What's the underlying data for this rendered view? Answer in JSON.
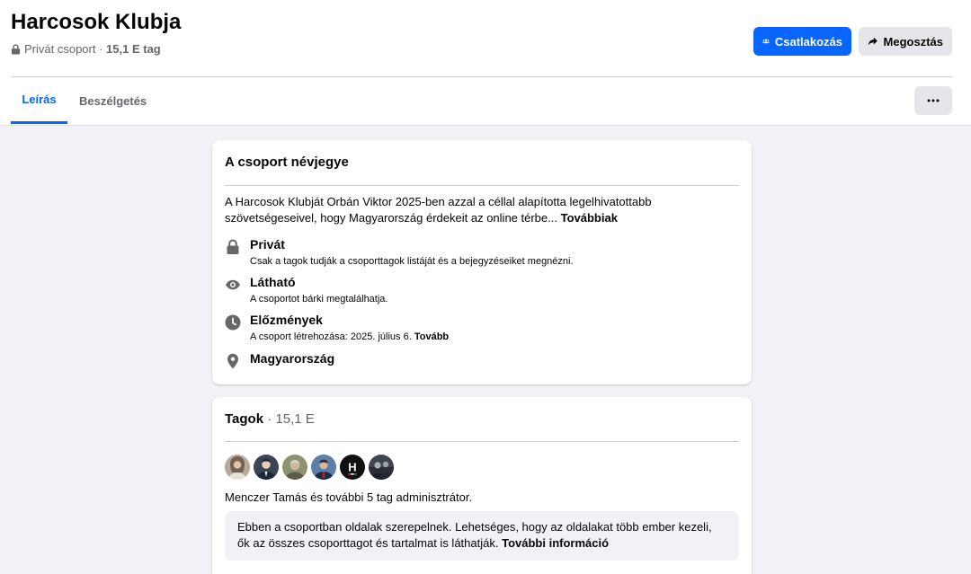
{
  "group": {
    "title": "Harcosok Klubja",
    "privacy": "Privát csoport",
    "separator": " · ",
    "member_count": "15,1 E tag"
  },
  "actions": {
    "join_label": "Csatlakozás",
    "share_label": "Megosztás",
    "more_label": "···"
  },
  "tabs": [
    {
      "label": "Leírás",
      "active": true
    },
    {
      "label": "Beszélgetés",
      "active": false
    }
  ],
  "about": {
    "title": "A csoport névjegye",
    "description": "A Harcosok Klubját Orbán Viktor 2025-ben azzal a céllal alapította legelhivatottabb szövetségeseivel, hogy Magyarország érdekeit az online térbe...",
    "more_link": "Továbbiak",
    "items": [
      {
        "icon": "lock-icon",
        "title": "Privát",
        "subtitle": "Csak a tagok tudják a csoporttagok listáját és a bejegyzéseiket megnézni.",
        "link": ""
      },
      {
        "icon": "eye-icon",
        "title": "Látható",
        "subtitle": "A csoportot bárki megtalálhatja.",
        "link": ""
      },
      {
        "icon": "clock-icon",
        "title": "Előzmények",
        "subtitle": "A csoport létrehozása: 2025. július 6.",
        "link": "Tovább"
      },
      {
        "icon": "location-pin-icon",
        "title": "Magyarország",
        "subtitle": "",
        "link": ""
      }
    ]
  },
  "members": {
    "title": "Tagok",
    "separator": " · ",
    "count": "15,1 E",
    "avatars": [
      {
        "name": "avatar-1",
        "bg": "#8a7a6c",
        "fg": "#d9c2a8"
      },
      {
        "name": "avatar-2",
        "bg": "#2d3440",
        "fg": "#e8d6c8"
      },
      {
        "name": "avatar-3",
        "bg": "#7f8a6a",
        "fg": "#c8b9a0"
      },
      {
        "name": "avatar-4",
        "bg": "#4a6b8f",
        "fg": "#d4b8a0"
      },
      {
        "name": "avatar-5",
        "bg": "#111111",
        "fg": "#ffffff",
        "letter": "H"
      },
      {
        "name": "avatar-6",
        "bg": "#3a4048",
        "fg": "#a9b0b6"
      }
    ],
    "admins_text": "Menczer Tamás és további 5 tag adminisztrátor.",
    "notice_text": "Ebben a csoportban oldalak szerepelnek. Lehetséges, hogy az oldalakat több ember kezeli, ők az összes csoporttagot és tartalmat is láthatják.",
    "notice_link": "További információ"
  },
  "colors": {
    "accent": "#0866ff",
    "icon_gray": "#65676b"
  }
}
